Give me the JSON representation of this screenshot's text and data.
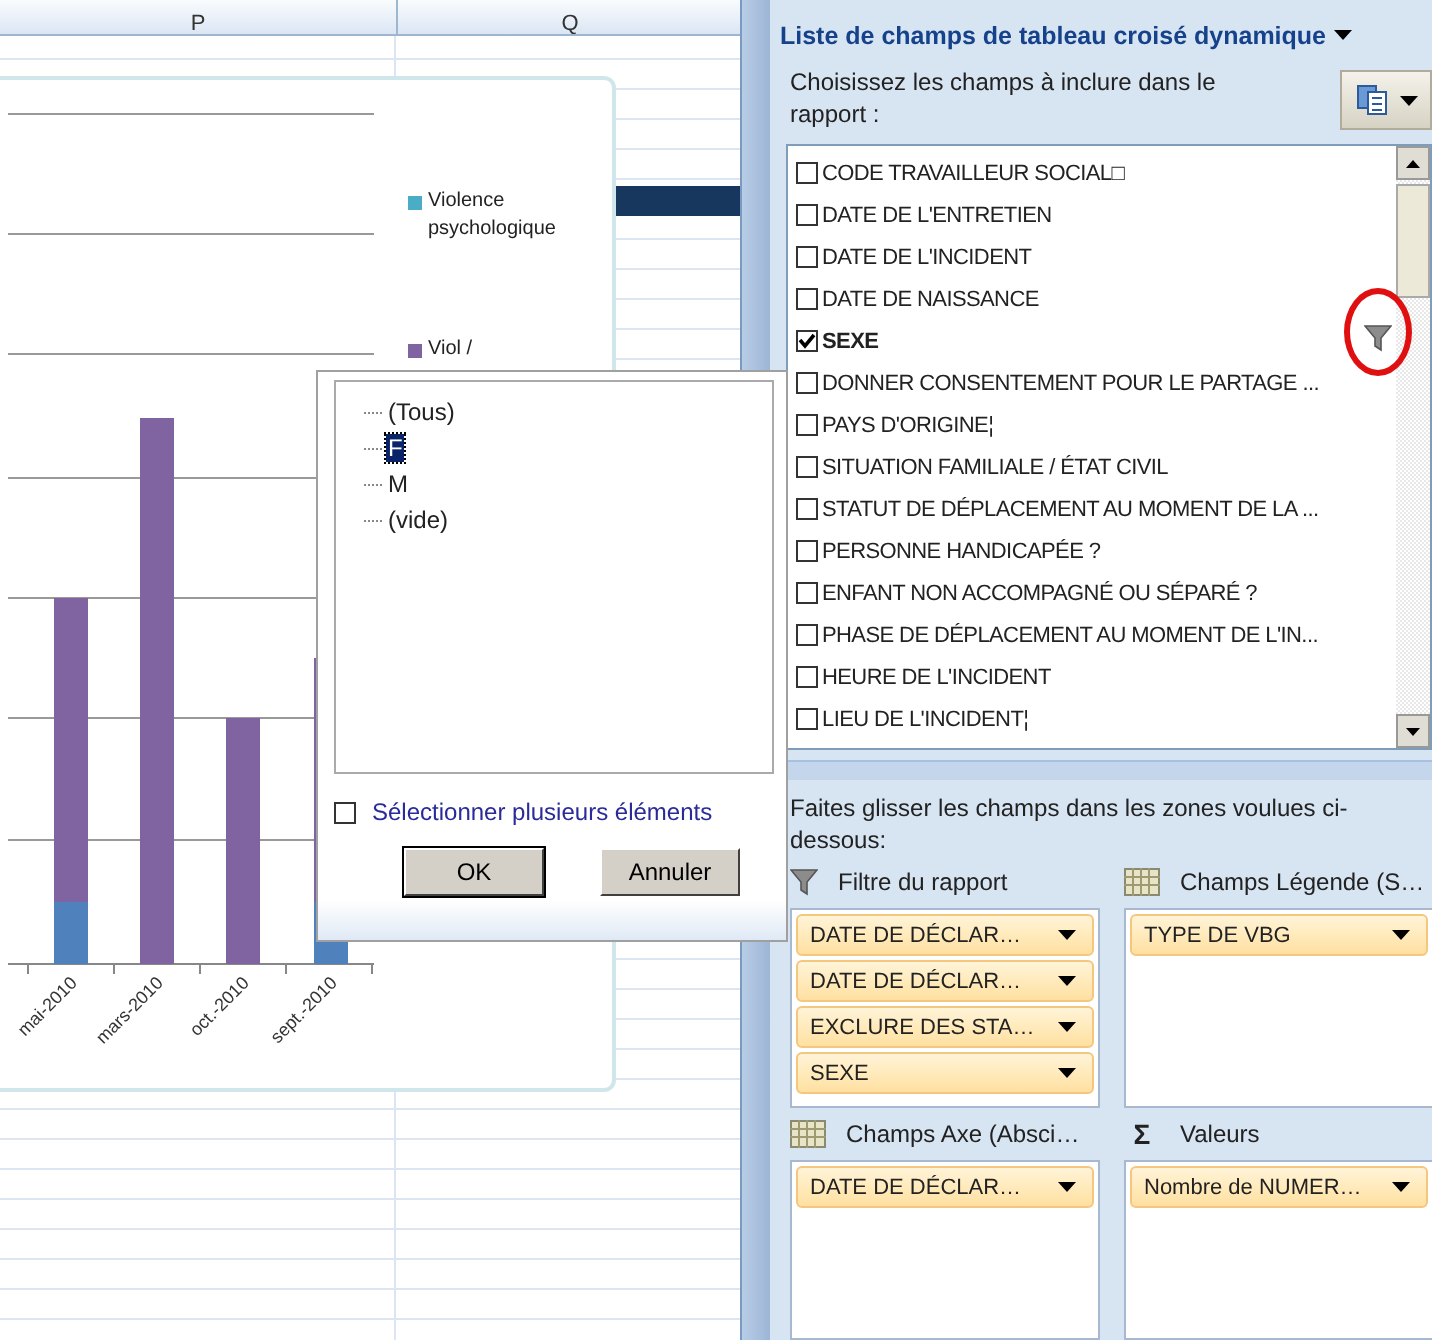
{
  "sheet": {
    "columns": [
      "P",
      "Q"
    ]
  },
  "chart": {
    "legend": [
      {
        "label": "Violence psychologique",
        "color": "#4bacc6"
      },
      {
        "label": "Viol /",
        "color": "#8064a2"
      }
    ],
    "categories": [
      "mai-2010",
      "mars-2010",
      "oct.-2010",
      "sept.-2010"
    ]
  },
  "filter_popup": {
    "items": [
      {
        "label": "(Tous)",
        "selected": false
      },
      {
        "label": "F",
        "selected": true
      },
      {
        "label": "M",
        "selected": false
      },
      {
        "label": "(vide)",
        "selected": false
      }
    ],
    "multi_select": {
      "label": "Sélectionner plusieurs éléments",
      "checked": false
    },
    "buttons": [
      "OK",
      "Annuler"
    ]
  },
  "field_list": {
    "title": "Liste de champs de tableau croisé dynamique",
    "instructions": "Choisissez les champs à inclure dans le rapport :",
    "fields": [
      {
        "label": "CODE TRAVAILLEUR SOCIAL□",
        "checked": false,
        "filtered": false
      },
      {
        "label": "DATE DE L'ENTRETIEN",
        "checked": false,
        "filtered": false
      },
      {
        "label": "DATE DE L'INCIDENT",
        "checked": false,
        "filtered": false
      },
      {
        "label": "DATE DE NAISSANCE",
        "checked": false,
        "filtered": false
      },
      {
        "label": "SEXE",
        "checked": true,
        "filtered": true
      },
      {
        "label": "DONNER CONSENTEMENT POUR LE PARTAGE ...",
        "checked": false,
        "filtered": false
      },
      {
        "label": "PAYS D'ORIGINE¦",
        "checked": false,
        "filtered": false
      },
      {
        "label": "SITUATION FAMILIALE / ÉTAT CIVIL",
        "checked": false,
        "filtered": false
      },
      {
        "label": "STATUT DE DÉPLACEMENT AU MOMENT DE LA ...",
        "checked": false,
        "filtered": false
      },
      {
        "label": "PERSONNE HANDICAPÉE ?",
        "checked": false,
        "filtered": false
      },
      {
        "label": "ENFANT NON ACCOMPAGNÉ OU SÉPARÉ ?",
        "checked": false,
        "filtered": false
      },
      {
        "label": "PHASE DE DÉPLACEMENT AU MOMENT DE L'IN...",
        "checked": false,
        "filtered": false
      },
      {
        "label": "HEURE DE L'INCIDENT",
        "checked": false,
        "filtered": false
      },
      {
        "label": "LIEU DE L'INCIDENT¦",
        "checked": false,
        "filtered": false
      }
    ],
    "drag_hint": "Faites glisser les champs dans les zones voulues ci-dessous:",
    "areas": [
      {
        "kind": "filter",
        "title": "Filtre du rapport",
        "chips": [
          "DATE DE DÉCLAR…",
          "DATE DE DÉCLAR…",
          "EXCLURE DES STA…",
          "SEXE"
        ]
      },
      {
        "kind": "legend",
        "title": "Champs Légende (S…",
        "chips": [
          "TYPE DE VBG"
        ]
      },
      {
        "kind": "axis",
        "title": "Champs Axe (Absci…",
        "chips": [
          "DATE DE DÉCLAR…"
        ]
      },
      {
        "kind": "values",
        "title": "Valeurs",
        "symbol": "Σ",
        "chips": [
          "Nombre de NUMER…"
        ]
      }
    ]
  }
}
